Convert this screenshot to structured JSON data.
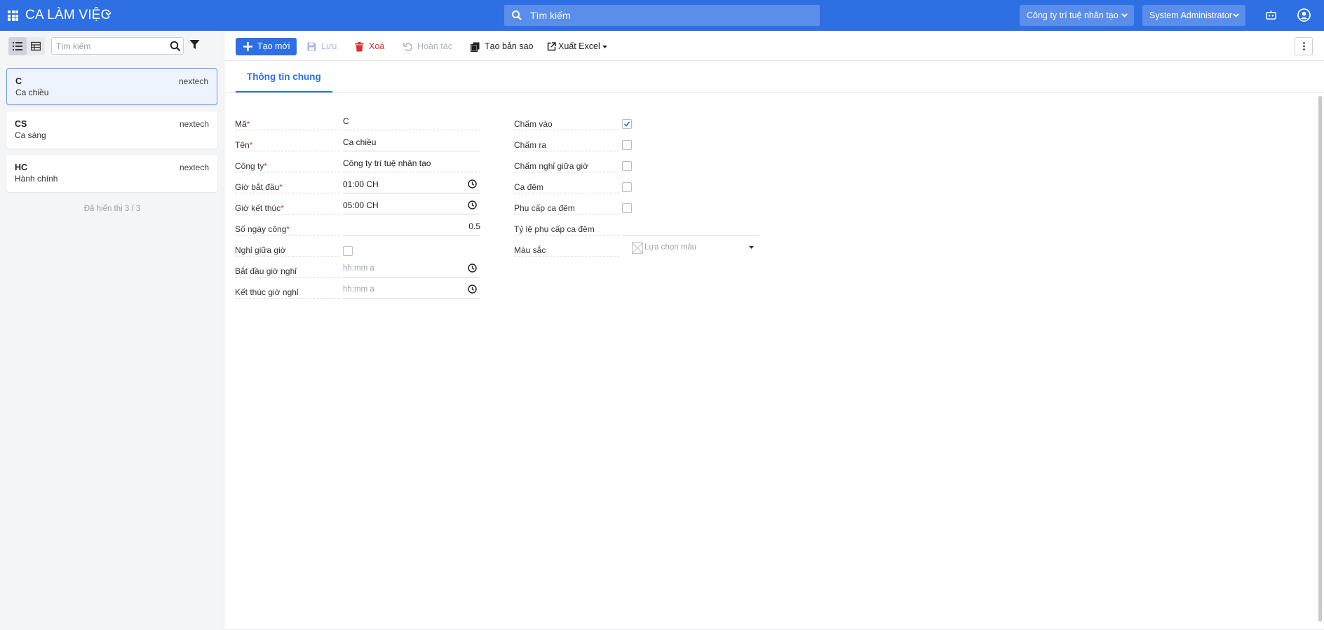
{
  "header": {
    "app_title": "CA LÀM VIỆC",
    "search_placeholder": "Tìm kiếm",
    "company": "Công ty trí tuệ nhân tạo",
    "user": "System Administrator"
  },
  "sidebar": {
    "search_placeholder": "Tìm kiếm",
    "items": [
      {
        "code": "C",
        "name": "Ca chiều",
        "org": "nextech"
      },
      {
        "code": "CS",
        "name": "Ca sáng",
        "org": "nextech"
      },
      {
        "code": "HC",
        "name": "Hành chính",
        "org": "nextech"
      }
    ],
    "count_text": "Đã hiển thị 3 / 3"
  },
  "toolbar": {
    "new_label": "Tạo mới",
    "save_label": "Lưu",
    "delete_label": "Xoá",
    "undo_label": "Hoàn tác",
    "copy_label": "Tạo bản sao",
    "export_label": "Xuất Excel"
  },
  "tabs": {
    "general": "Thông tin chung"
  },
  "form": {
    "left": {
      "code": {
        "label": "Mã",
        "value": "C"
      },
      "name": {
        "label": "Tên",
        "value": "Ca chiều"
      },
      "company": {
        "label": "Công ty",
        "value": "Công ty trí tuệ nhân tạo"
      },
      "start": {
        "label": "Giờ bắt đầu",
        "value": "01:00 CH"
      },
      "end": {
        "label": "Giờ kết thúc",
        "value": "05:00 CH"
      },
      "workdays": {
        "label": "Số ngày công",
        "value": "0.5"
      },
      "break": {
        "label": "Nghỉ giữa giờ"
      },
      "break_start": {
        "label": "Bắt đầu giờ nghỉ",
        "placeholder": "hh:mm a"
      },
      "break_end": {
        "label": "Kết thúc giờ nghỉ",
        "placeholder": "hh:mm a"
      }
    },
    "right": {
      "check_in": {
        "label": "Chấm vào",
        "checked": true
      },
      "check_out": {
        "label": "Chấm ra",
        "checked": false
      },
      "check_break": {
        "label": "Chấm nghỉ giữa giờ",
        "checked": false
      },
      "night": {
        "label": "Ca đêm",
        "checked": false
      },
      "night_allowance": {
        "label": "Phụ cấp ca đêm",
        "checked": false
      },
      "night_rate": {
        "label": "Tỷ lệ phụ cấp ca đêm",
        "value": ""
      },
      "color": {
        "label": "Màu sắc",
        "placeholder": "Lựa chọn màu"
      }
    }
  },
  "colors": {
    "primary": "#2f6fe4",
    "danger": "#d93030",
    "required": "#e53935"
  }
}
